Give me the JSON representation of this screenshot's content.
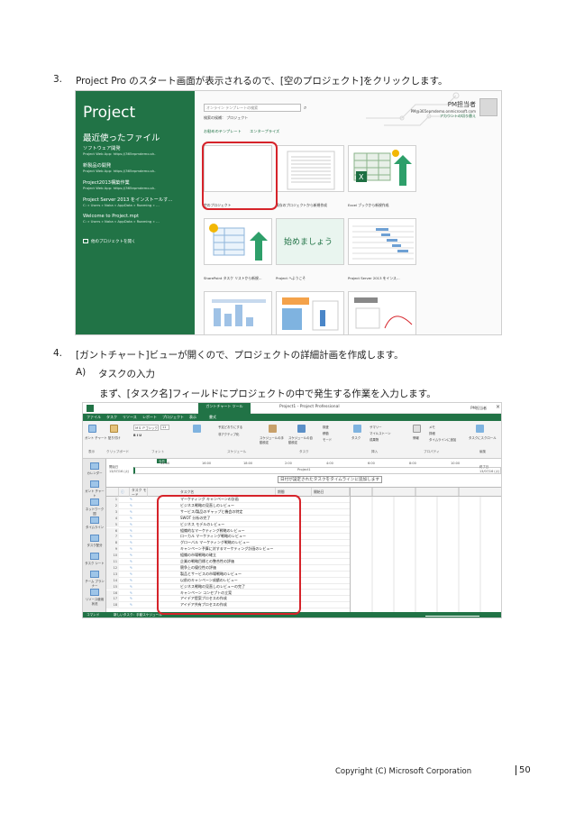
{
  "steps": {
    "s3": {
      "num": "3.",
      "text": "Project Pro のスタート画面が表示されるので、[空のプロジェクト]をクリックします。"
    },
    "s4": {
      "num": "4.",
      "text": "[ガントチャート]ビューが開くので、プロジェクトの詳細計画を作成します。"
    },
    "sA": {
      "num": "A)",
      "text": "タスクの入力"
    },
    "sA_desc": "まず、[タスク名]フィールドにプロジェクトの中で発生する作業を入力します。"
  },
  "start_screen": {
    "app_title": "Project",
    "recent_heading": "最近使ったファイル",
    "recent_files": [
      {
        "title": "ソフトウェア開発",
        "path": "Project Web App: https://365epmdemo.sh-"
      },
      {
        "title": "新製品の開発",
        "path": "Project Web App: https://365epmdemo.sh-"
      },
      {
        "title": "Project2013構築作業",
        "path": "Project Web App: https://365epmdemo.sh-"
      },
      {
        "title": "Project Server 2013 をインストールす…",
        "path": "C: » Users » Naka » AppData » Roaming » …"
      },
      {
        "title": "Welcome to Project.mpt",
        "path": "C: » Users » Naka » AppData » Roaming » …"
      }
    ],
    "open_other": "他のプロジェクトを開く",
    "search_placeholder": "オンライン テンプレートの検索",
    "suggest": "検索の候補：  プロジェクト",
    "tabs": [
      "お勧めのテンプレート",
      "エンタープライズ"
    ],
    "user": {
      "name": "PM担当者",
      "email": "PM@365epmdemo.onmicrosoft.com",
      "link": "アカウントの切り替え"
    },
    "templates": [
      {
        "caption": "空のプロジェクト"
      },
      {
        "caption": "既存のプロジェクトから新規作成"
      },
      {
        "caption": "Excel ブックから新規作成"
      },
      {
        "caption": "SharePoint タスク リストから新規…"
      },
      {
        "caption": "Project へようこそ"
      },
      {
        "caption": "Project Server 2013 をインス…"
      }
    ],
    "welcome_tile_text": "始めましょう"
  },
  "gantt_screen": {
    "context_tab": "ガントチャート ツール",
    "window_title": "Project1 - Project Professional",
    "user": "PM担当者",
    "tabs": [
      "ファイル",
      "タスク",
      "リソース",
      "レポート",
      "プロジェクト",
      "表示",
      "書式"
    ],
    "ribbon_groups": [
      "表示",
      "クリップボード",
      "フォント",
      "スケジュール",
      "タスク",
      "挿入",
      "プロパティ",
      "編集"
    ],
    "ribbon_buttons": {
      "gantt": "ガント チャート",
      "paste": "貼り付け",
      "font": "ＭＳ Ｐゴシック",
      "font_size": "11",
      "respect_links": "予定どおりにする",
      "inactivate": "非アクティブ化",
      "manual": "スケジュールの手動設定",
      "auto": "スケジュールの自動設定",
      "inspect": "検査",
      "move": "移動",
      "mode": "モード",
      "task": "タスク",
      "summary": "サマリー",
      "milestone": "マイルストーン",
      "deliverable": "成果物",
      "info": "情報",
      "notes": "メモ",
      "details": "詳細",
      "timeline_add": "タイムラインに追加",
      "scroll": "タスクにスクロール"
    },
    "side_views": [
      "カレンダー",
      "ガント チャート",
      "ネットワーク図",
      "タイムライン",
      "タスク配分",
      "タスク シート",
      "チーム プランナー",
      "リソース使用状況"
    ],
    "timeline": {
      "today": "今日",
      "start_label": "開始日",
      "start_date": "13/07/16 (火)",
      "ticks": [
        "14:00",
        "16:00",
        "18:00",
        "2:00",
        "4:00",
        "6:00",
        "8:00",
        "10:00",
        "12:00"
      ],
      "end_label": "終了日",
      "end_date": "13/07/16 (火)",
      "hint": "日付が設定されたタスクをタイムラインに追加します",
      "bar_label": "Project1"
    },
    "headers": {
      "info": "ⓘ",
      "mode": "タスク モード",
      "name": "タスク名",
      "duration": "期間",
      "start": "開始日"
    },
    "tasks": [
      "マーケティング キャンペーンの計画",
      "ビジネス戦略の見直しのレビュー",
      "サービス/製品のギャップと機会の特定",
      "SWOT 分析の完了",
      "ビジネス モデルのレビュー",
      "組織的なマーケティング戦略のレビュー",
      "ローカル マーケティング戦略のレビュー",
      "グローバル マーケティング戦略のレビュー",
      "キャンペーン予算に対するマーケティング計画のレビュー",
      "組織の市場戦略の確立",
      "企業の戦略目標との整合性の評価",
      "競争上の優位性の評価",
      "製品とサービスの市場戦略のレビュー",
      "以前のキャンペーン成績のレビュー",
      "ビジネス戦略の見直しのレビューの完了",
      "キャンペーン コンセプトの立案",
      "アイデア提案プロセスの作成",
      "アイデア共有プロセスの作成"
    ],
    "status": {
      "ready": "コマンド",
      "new_tasks": "新しいタスク：手動スケジュール"
    }
  },
  "footer": {
    "copyright": "Copyright (C)   Microsoft Corporation",
    "page": "50"
  },
  "colors": {
    "project_green": "#217346",
    "highlight_red": "#d6232a"
  }
}
